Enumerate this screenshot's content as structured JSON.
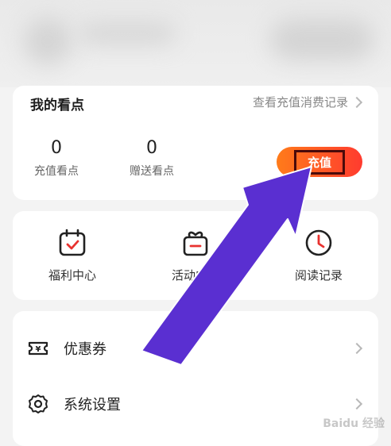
{
  "points_card": {
    "title": "我的看点",
    "history_link": "查看充值消费记录",
    "recharge_points": {
      "value": "0",
      "label": "充值看点"
    },
    "gift_points": {
      "value": "0",
      "label": "赠送看点"
    },
    "recharge_button": "充值"
  },
  "shortcuts": [
    {
      "label": "福利中心",
      "icon": "calendar-check-icon"
    },
    {
      "label": "活动中心",
      "icon": "gift-box-icon"
    },
    {
      "label": "阅读记录",
      "icon": "clock-icon"
    }
  ],
  "menu": [
    {
      "label": "优惠券",
      "icon": "coupon-icon"
    },
    {
      "label": "系统设置",
      "icon": "gear-icon"
    }
  ],
  "watermark": "Baidu 经验",
  "colors": {
    "accent": "#e8322f",
    "button_start": "#ff7b1a",
    "button_end": "#ff3b2f",
    "arrow": "#5a2fd1"
  }
}
